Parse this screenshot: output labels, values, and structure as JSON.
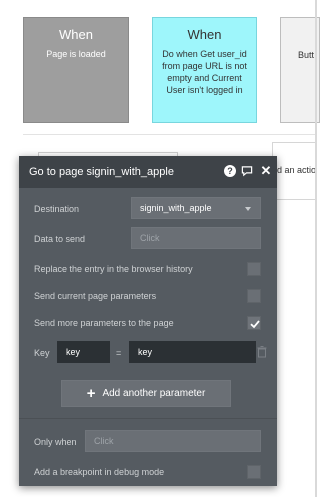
{
  "canvas": {
    "cards": {
      "trigger": {
        "title": "When",
        "subtitle": "Page is loaded"
      },
      "action": {
        "title": "When",
        "subtitle": "Do when Get user_id from page URL is not empty and Current User isn't logged in"
      },
      "next": {
        "subtitle": "Butt"
      }
    },
    "side_panel_text": "d an actio"
  },
  "editor": {
    "title": "Go to page signin_with_apple",
    "destination": {
      "label": "Destination",
      "value": "signin_with_apple"
    },
    "data_to_send": {
      "label": "Data to send",
      "placeholder": "Click"
    },
    "replace_history": {
      "label": "Replace the entry in the browser history",
      "checked": false
    },
    "send_current_params": {
      "label": "Send current page parameters",
      "checked": false
    },
    "send_more_params": {
      "label": "Send more parameters to the page",
      "checked": true
    },
    "parameter": {
      "key_label": "Key",
      "key_value": "key",
      "equals": "=",
      "value": "key"
    },
    "add_parameter_label": "Add another parameter",
    "only_when": {
      "label": "Only when",
      "placeholder": "Click"
    },
    "breakpoint": {
      "label": "Add a breakpoint in debug mode",
      "checked": false
    }
  },
  "icons": {
    "help": "question-circle-icon",
    "comment": "comment-bubble-icon",
    "close": "close-icon",
    "plus": "plus-icon",
    "trash": "trash-icon",
    "check": "checkmark-icon",
    "dropdown": "chevron-down-icon"
  },
  "colors": {
    "trigger_card": "#9e9e9e",
    "action_card": "#9ef6fb",
    "editor_bg": "#555b61",
    "editor_header": "#3e4348",
    "dark_field": "#2b3034"
  }
}
